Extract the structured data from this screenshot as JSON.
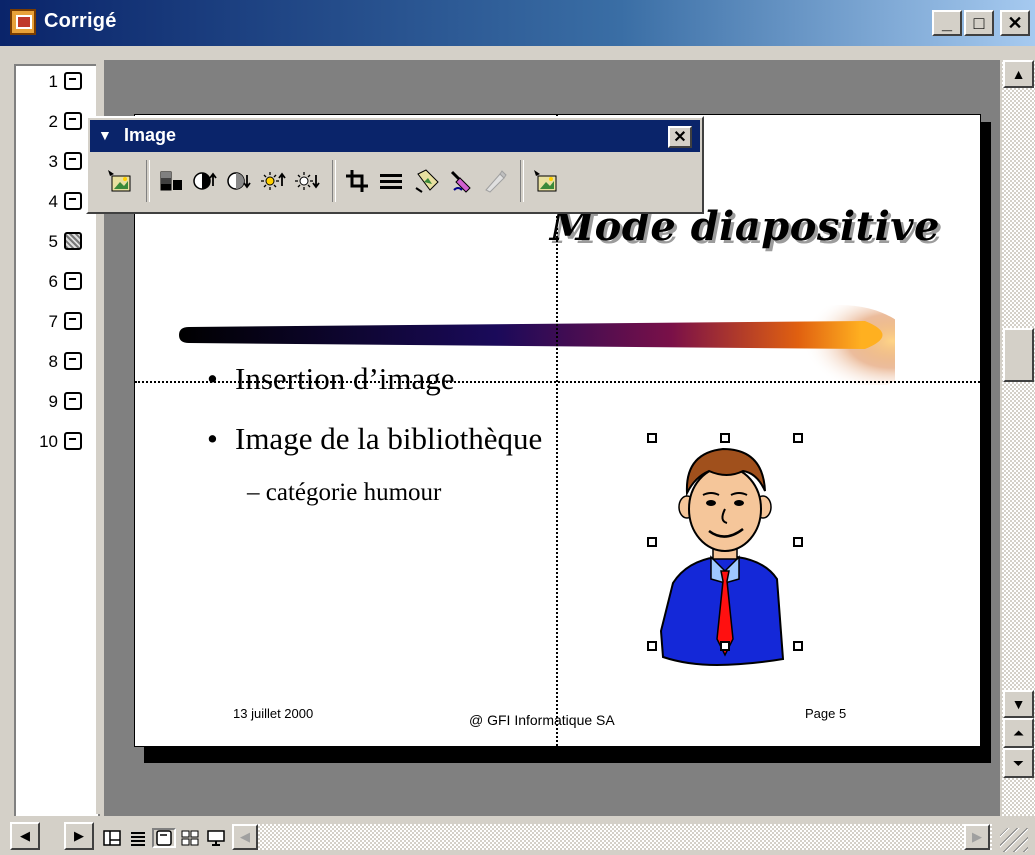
{
  "window": {
    "title": "Corrigé",
    "min_glyph": "_",
    "max_glyph": "□",
    "close_glyph": "✕"
  },
  "outline": {
    "slides": [
      {
        "num": "1",
        "active": false
      },
      {
        "num": "2",
        "active": false
      },
      {
        "num": "3",
        "active": false
      },
      {
        "num": "4",
        "active": false
      },
      {
        "num": "5",
        "active": true
      },
      {
        "num": "6",
        "active": false
      },
      {
        "num": "7",
        "active": false
      },
      {
        "num": "8",
        "active": false
      },
      {
        "num": "9",
        "active": false
      },
      {
        "num": "10",
        "active": false
      }
    ]
  },
  "toolbar": {
    "title": "Image",
    "close_glyph": "✕",
    "tools": [
      "insert-picture-icon",
      "image-color-icon",
      "more-contrast-icon",
      "less-contrast-icon",
      "more-brightness-icon",
      "less-brightness-icon",
      "crop-icon",
      "line-style-icon",
      "format-picture-icon",
      "set-transparent-color-icon",
      "recolor-picture-icon",
      "reset-picture-icon"
    ]
  },
  "slide": {
    "title": "Mode diapositive",
    "bullets": [
      "Insertion d’image",
      "Image de la bibliothèque"
    ],
    "bullet_glyph": "•",
    "sub_bullet_glyph": "–",
    "sub_bullets": [
      "catégorie humour"
    ],
    "footer": {
      "date": "13 juillet 2000",
      "copyright": "@ GFI Informatique SA",
      "page": "Page 5"
    }
  },
  "scrollbar": {
    "up_glyph": "▲",
    "down_glyph": "▼",
    "prev_slide_glyph": "⏶",
    "next_slide_glyph": "⏷"
  },
  "bottom_bar": {
    "nav_left_glyph": "◀",
    "nav_right_glyph": "▶",
    "views": [
      "normal-view",
      "outline-view",
      "slide-view",
      "slide-sorter-view",
      "slide-show-view"
    ],
    "hscroll_left_glyph": "◀",
    "hscroll_right_glyph": "▶"
  },
  "colors": {
    "title_bar": "#0a246a",
    "toolbar_title": "#0a246a",
    "slide_background": "#ffffff",
    "pane_background": "#808080"
  }
}
